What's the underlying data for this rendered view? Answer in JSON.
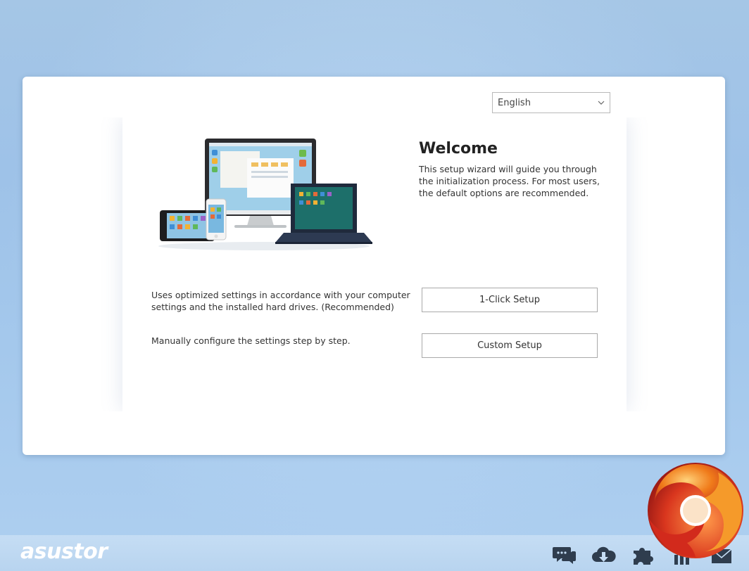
{
  "language_select": {
    "value": "English",
    "icon": "chevron-down-icon"
  },
  "welcome": {
    "title": "Welcome",
    "description": "This setup wizard will guide you through the initialization process. For most users, the default options are recommended."
  },
  "options": [
    {
      "description": "Uses optimized settings in accordance with your computer settings and the installed hard drives. (Recommended)",
      "button_label": "1-Click Setup"
    },
    {
      "description": "Manually configure the settings step by step.",
      "button_label": "Custom Setup"
    }
  ],
  "taskbar": {
    "logo": "asustor",
    "icons": [
      "chat-icon",
      "cloud-download-icon",
      "plugin-icon",
      "bar-chart-icon",
      "mail-icon"
    ]
  },
  "colors": {
    "background": "#a5c6e6",
    "card": "#ffffff",
    "taskbar": "#bdd7f1",
    "swirl_orange": "#f07b1a",
    "swirl_red": "#c41c1c"
  }
}
